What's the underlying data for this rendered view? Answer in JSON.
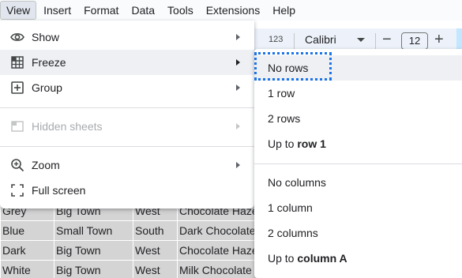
{
  "menubar": {
    "items": [
      "View",
      "Insert",
      "Format",
      "Data",
      "Tools",
      "Extensions",
      "Help"
    ],
    "active": "View"
  },
  "toolbar": {
    "number_format": "123",
    "font": "Calibri",
    "minus": "−",
    "font_size": "12",
    "plus": "+"
  },
  "view_menu": {
    "items": [
      {
        "label": "Show",
        "icon": "eye-icon",
        "submenu": true
      },
      {
        "label": "Freeze",
        "icon": "freeze-grid-icon",
        "submenu": true
      },
      {
        "label": "Group",
        "icon": "group-plus-box-icon",
        "submenu": true
      },
      {
        "label": "Hidden sheets",
        "icon": "hidden-sheet-icon",
        "submenu": true,
        "disabled": true
      },
      {
        "label": "Zoom",
        "icon": "zoom-in-icon",
        "submenu": true
      },
      {
        "label": "Full screen",
        "icon": "fullscreen-icon",
        "submenu": false
      }
    ]
  },
  "freeze_submenu": {
    "no_rows": "No rows",
    "one_row": "1 row",
    "two_rows": "2 rows",
    "up_to_prefix": "Up to ",
    "up_to_row": "row 1",
    "no_columns": "No columns",
    "one_column": "1 column",
    "two_columns": "2 columns",
    "up_to_column": "column A"
  },
  "sheet": {
    "rows": [
      [
        "Grey",
        "Big Town",
        "West",
        "Chocolate Hazelnut"
      ],
      [
        "Blue",
        "Small Town",
        "South",
        "Dark Chocolate"
      ],
      [
        "Dark",
        "Big Town",
        "West",
        "Chocolate Hazelnut"
      ],
      [
        "White",
        "Big Town",
        "West",
        "Milk Chocolate"
      ]
    ]
  }
}
